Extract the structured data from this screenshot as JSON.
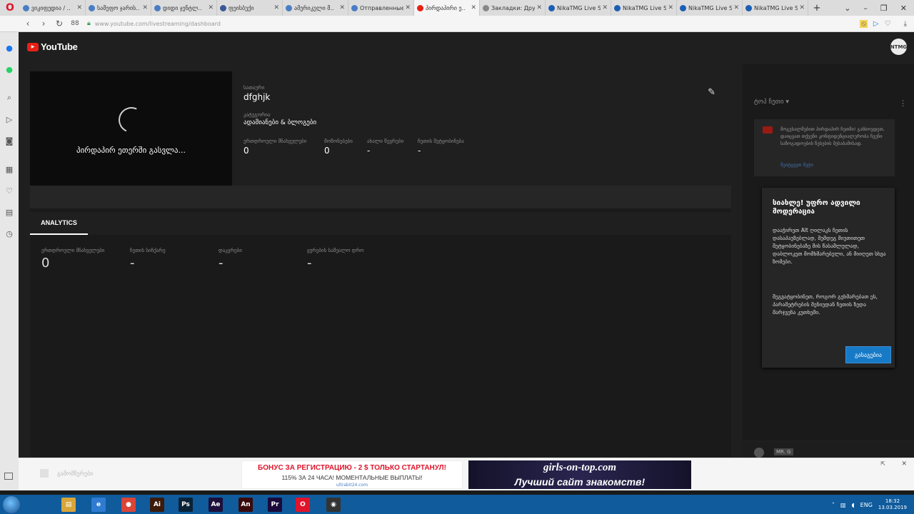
{
  "browser": {
    "tabs": [
      {
        "label": "ვიკიფედია / ..",
        "color": "#4a7dc4"
      },
      {
        "label": "სამეფო ჯარის..",
        "color": "#4a7dc4"
      },
      {
        "label": "დიდი ჯენტლ..",
        "color": "#4a7dc4"
      },
      {
        "label": "ფეისბუქი",
        "color": "#3b5998"
      },
      {
        "label": "ამერიკული მ..",
        "color": "#4a7dc4"
      },
      {
        "label": "Отправленные",
        "color": "#4a7dc4"
      },
      {
        "label": "პირდაპირი ე..",
        "color": "#e62117"
      },
      {
        "label": "Закладки: Дру",
        "color": "#888888"
      },
      {
        "label": "NikaTMG Live S",
        "color": "#1a5fb4"
      },
      {
        "label": "NikaTMG Live S",
        "color": "#1a5fb4"
      },
      {
        "label": "NikaTMG Live S",
        "color": "#1a5fb4"
      },
      {
        "label": "NikaTMG Live S",
        "color": "#1a5fb4"
      }
    ],
    "active_tab": 6,
    "url": "www.youtube.com/livestreaming/dashboard",
    "speed_dial": "88"
  },
  "youtube": {
    "logo_text": "YouTube",
    "avatar_text": "NTMG",
    "preview_status": "პირდაპირ ეთერში გასვლა...",
    "title_label": "სათაური",
    "title_value": "dfghjk",
    "category_label": "კატეგორია",
    "category_value": "ადამიანები & ბლოგები",
    "stats": [
      {
        "label": "ერთდროული მნახველები",
        "value": "0"
      },
      {
        "label": "მოწონებები",
        "value": "0"
      },
      {
        "label": "ახალი წევრები",
        "value": "-"
      },
      {
        "label": "ჩეთის შეტყობინება",
        "value": "-"
      }
    ],
    "analytics_tab": "ANALYTICS",
    "analytics": [
      {
        "label": "ერთდროული მნახველები",
        "value": "0"
      },
      {
        "label": "ჩეთის სიჩქარე",
        "value": "-"
      },
      {
        "label": "დაკვრები",
        "value": "-"
      },
      {
        "label": "ყურების საშუალო დრო",
        "value": "-"
      }
    ]
  },
  "chat": {
    "header": "ტოპ ჩეთი",
    "message": "მოგესალმებით პირდაპირ ჩეთში! გახსოვდეთ, დაიცვათ თქვენი კონფიდენციალურობა ჩვენი საზოგადოების წესების შესაბამისად.",
    "link": "შეიტყვეთ მეტი"
  },
  "popup": {
    "title": "სიახლე! უფრო ადვილი მოდერაცია",
    "body1": "დააჭირეთ Alt ღილაკს ჩეთის დასაპაუზებლად, შემდეგ მიუთითეთ შეტყობინებაზე მის წასაშლელად, დაბლოკეთ მომხმარებელი, ან მიიღეთ სხვა ზომები.",
    "body2": "შეგვატყობინეთ, როგორ გეხმარებათ ეს, პარამეტრების მენიუდან ჩეთის ზედა მარჯვენა კუთხეში.",
    "button": "გასაგებია"
  },
  "chat_footer": {
    "name": "MR. G"
  },
  "ad": {
    "left_label": "გამომწერები",
    "ad1_line1": "БОНУС ЗА РЕГИСТРАЦИЮ - 2 $ ТОЛЬКО СТАРТАНУЛ!",
    "ad1_line2": "115% ЗА 24 ЧАСА! МОМЕНТАЛЬНЫЕ ВЫПЛАТЫ!",
    "ad1_line3": "ultrabit24.com",
    "ad2_line1": "girls-on-top.com",
    "ad2_line2": "Лучший сайт знакомств!"
  },
  "taskbar": {
    "apps": [
      {
        "name": "file-explorer",
        "glyph": "▤",
        "color": "#d9a53a"
      },
      {
        "name": "internet-explorer",
        "glyph": "e",
        "color": "#2e7bd1"
      },
      {
        "name": "chrome",
        "glyph": "●",
        "color": "#db4437"
      },
      {
        "name": "illustrator",
        "glyph": "Ai",
        "color": "#3b1a0a"
      },
      {
        "name": "photoshop",
        "glyph": "Ps",
        "color": "#0a2236"
      },
      {
        "name": "after-effects",
        "glyph": "Ae",
        "color": "#1c0f3a"
      },
      {
        "name": "animate",
        "glyph": "An",
        "color": "#3a0a0a"
      },
      {
        "name": "premiere",
        "glyph": "Pr",
        "color": "#1a0a3a"
      },
      {
        "name": "opera",
        "glyph": "O",
        "color": "#e0142a"
      },
      {
        "name": "obs",
        "glyph": "◉",
        "color": "#333333"
      }
    ],
    "lang": "ENG",
    "time": "18:32",
    "date": "13.03.2019"
  }
}
